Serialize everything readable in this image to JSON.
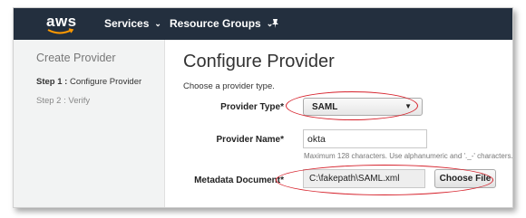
{
  "nav": {
    "logo": "aws",
    "services_label": "Services",
    "resource_groups_label": "Resource Groups",
    "pin_icon": "pin-icon"
  },
  "sidebar": {
    "title": "Create Provider",
    "step1_prefix": "Step 1 :",
    "step1_label": "Configure Provider",
    "step2_label": "Step 2 : Verify"
  },
  "main": {
    "title": "Configure Provider",
    "subtitle": "Choose a provider type.",
    "provider_type_label": "Provider Type*",
    "provider_type_value": "SAML",
    "provider_name_label": "Provider Name*",
    "provider_name_value": "okta",
    "provider_name_hint": "Maximum 128 characters. Use alphanumeric and '._-' characters.",
    "metadata_label": "Metadata Document*",
    "metadata_value": "C:\\fakepath\\SAML.xml",
    "choose_file_label": "Choose File"
  },
  "colors": {
    "nav_bg": "#232f3e",
    "sidebar_bg": "#f2f3f3",
    "annotation": "#d6202a",
    "aws_orange": "#ff9900"
  }
}
